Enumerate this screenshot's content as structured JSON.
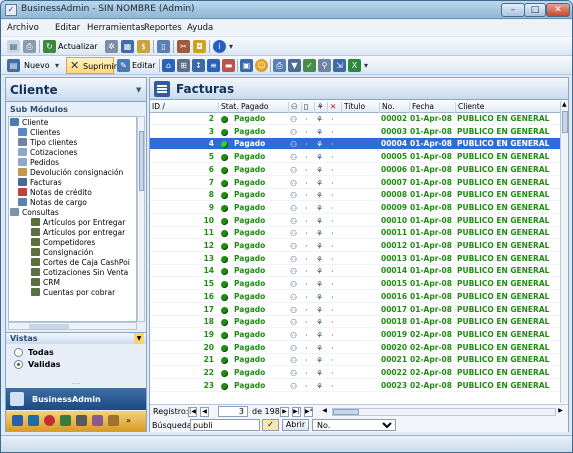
{
  "window": {
    "title": "BusinessAdmin - SIN NOMBRE (Admin)"
  },
  "menu": [
    "Archivo",
    "Editar",
    "Herramientas",
    "Reportes",
    "Ayuda"
  ],
  "toolbar1": {
    "update_label": "Actualizar"
  },
  "toolbar2": {
    "new_label": "Nuevo",
    "delete_label": "Suprimir",
    "edit_label": "Editar"
  },
  "left": {
    "title": "Cliente",
    "submodules_label": "Sub Módulos",
    "tree": [
      "Cliente",
      "Clientes",
      "Tipo clientes",
      "Cotizaciones",
      "Pedidos",
      "Devolución consignación",
      "Facturas",
      "Notas de crédito",
      "Notas de cargo",
      "Consultas",
      "Artículos por Entregar",
      "Artículos por entregar",
      "Competidores",
      "Consignación",
      "Cortes de Caja CashPoi",
      "Cotizaciones Sin Venta",
      "CRM",
      "Cuentas por cobrar"
    ],
    "views_label": "Vistas",
    "views": [
      "Todas",
      "Validas"
    ],
    "selected_view": "Validas",
    "brand": "BusinessAdmin"
  },
  "main": {
    "title": "Facturas",
    "columns": [
      "ID",
      "Stat. Pagado",
      "",
      "",
      "",
      "",
      "Título",
      "No.",
      "Fecha",
      "Cliente"
    ],
    "selected_row": 3,
    "rows": [
      {
        "id": "2",
        "status": "Pagado",
        "no": "00002",
        "date": "01-Apr-08",
        "client": "PUBLICO EN GENERAL"
      },
      {
        "id": "3",
        "status": "Pagado",
        "no": "00003",
        "date": "01-Apr-08",
        "client": "PUBLICO EN GENERAL"
      },
      {
        "id": "4",
        "status": "Pagado",
        "no": "00004",
        "date": "01-Apr-08",
        "client": "PUBLICO EN GENERAL"
      },
      {
        "id": "5",
        "status": "Pagado",
        "no": "00005",
        "date": "01-Apr-08",
        "client": "PUBLICO EN GENERAL"
      },
      {
        "id": "6",
        "status": "Pagado",
        "no": "00006",
        "date": "01-Apr-08",
        "client": "PUBLICO EN GENERAL"
      },
      {
        "id": "7",
        "status": "Pagado",
        "no": "00007",
        "date": "01-Apr-08",
        "client": "PUBLICO EN GENERAL"
      },
      {
        "id": "8",
        "status": "Pagado",
        "no": "00008",
        "date": "01-Apr-08",
        "client": "PUBLICO EN GENERAL"
      },
      {
        "id": "9",
        "status": "Pagado",
        "no": "00009",
        "date": "01-Apr-08",
        "client": "PUBLICO EN GENERAL"
      },
      {
        "id": "10",
        "status": "Pagado",
        "no": "00010",
        "date": "01-Apr-08",
        "client": "PUBLICO EN GENERAL"
      },
      {
        "id": "11",
        "status": "Pagado",
        "no": "00011",
        "date": "01-Apr-08",
        "client": "PUBLICO EN GENERAL"
      },
      {
        "id": "12",
        "status": "Pagado",
        "no": "00012",
        "date": "01-Apr-08",
        "client": "PUBLICO EN GENERAL"
      },
      {
        "id": "13",
        "status": "Pagado",
        "no": "00013",
        "date": "01-Apr-08",
        "client": "PUBLICO EN GENERAL"
      },
      {
        "id": "14",
        "status": "Pagado",
        "no": "00014",
        "date": "01-Apr-08",
        "client": "PUBLICO EN GENERAL"
      },
      {
        "id": "15",
        "status": "Pagado",
        "no": "00015",
        "date": "01-Apr-08",
        "client": "PUBLICO EN GENERAL"
      },
      {
        "id": "16",
        "status": "Pagado",
        "no": "00016",
        "date": "01-Apr-08",
        "client": "PUBLICO EN GENERAL"
      },
      {
        "id": "17",
        "status": "Pagado",
        "no": "00017",
        "date": "01-Apr-08",
        "client": "PUBLICO EN GENERAL"
      },
      {
        "id": "18",
        "status": "Pagado",
        "no": "00018",
        "date": "01-Apr-08",
        "client": "PUBLICO EN GENERAL"
      },
      {
        "id": "19",
        "status": "Pagado",
        "no": "00019",
        "date": "02-Apr-08",
        "client": "PUBLICO EN GENERAL"
      },
      {
        "id": "20",
        "status": "Pagado",
        "no": "00020",
        "date": "02-Apr-08",
        "client": "PUBLICO EN GENERAL"
      },
      {
        "id": "21",
        "status": "Pagado",
        "no": "00021",
        "date": "02-Apr-08",
        "client": "PUBLICO EN GENERAL"
      },
      {
        "id": "22",
        "status": "Pagado",
        "no": "00022",
        "date": "02-Apr-08",
        "client": "PUBLICO EN GENERAL"
      },
      {
        "id": "23",
        "status": "Pagado",
        "no": "00023",
        "date": "02-Apr-08",
        "client": "PUBLICO EN GENERAL"
      }
    ]
  },
  "nav": {
    "records_label": "Registro:",
    "current": "3",
    "of_label": "de 198"
  },
  "search": {
    "label": "Búsqueda",
    "value": "publi",
    "open_label": "Abrir",
    "field": "No."
  },
  "colors": {
    "accent": "#2f6cd8",
    "paid_green": "#1f8c12",
    "title_navy": "#13325a"
  }
}
